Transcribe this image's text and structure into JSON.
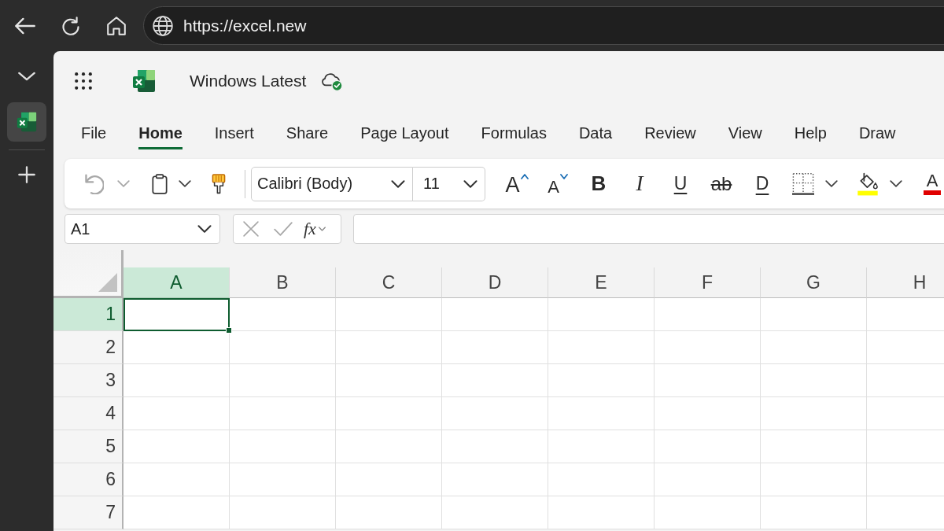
{
  "browser": {
    "url": "https://excel.new"
  },
  "sidebar": {
    "tabs": [
      {
        "selected": true
      }
    ]
  },
  "app": {
    "document_title": "Windows Latest"
  },
  "tabs": [
    {
      "label": "File",
      "selected": false
    },
    {
      "label": "Home",
      "selected": true
    },
    {
      "label": "Insert",
      "selected": false
    },
    {
      "label": "Share",
      "selected": false
    },
    {
      "label": "Page Layout",
      "selected": false
    },
    {
      "label": "Formulas",
      "selected": false
    },
    {
      "label": "Data",
      "selected": false
    },
    {
      "label": "Review",
      "selected": false
    },
    {
      "label": "View",
      "selected": false
    },
    {
      "label": "Help",
      "selected": false
    },
    {
      "label": "Draw",
      "selected": false
    }
  ],
  "ribbon": {
    "undo": {
      "disabled": true
    },
    "font_name": "Calibri (Body)",
    "font_size": "11",
    "format_buttons": [
      {
        "kind": "grow-font",
        "glyph": "A"
      },
      {
        "kind": "shrink-font",
        "glyph": "A"
      },
      {
        "kind": "bold",
        "glyph": "B"
      },
      {
        "kind": "italic",
        "glyph": "I"
      },
      {
        "kind": "underline",
        "glyph": "U"
      },
      {
        "kind": "strikethrough",
        "glyph": "ab"
      },
      {
        "kind": "double-underline",
        "glyph": "D"
      },
      {
        "kind": "borders"
      },
      {
        "kind": "fill-color"
      },
      {
        "kind": "font-color",
        "glyph": "A"
      }
    ]
  },
  "formula_bar": {
    "name_box": "A1",
    "cancel_disabled": true,
    "enter_disabled": true,
    "function_label": "fx"
  },
  "sheet": {
    "columns": [
      {
        "label": "A",
        "selected": true
      },
      {
        "label": "B",
        "selected": false
      },
      {
        "label": "C",
        "selected": false
      },
      {
        "label": "D",
        "selected": false
      },
      {
        "label": "E",
        "selected": false
      },
      {
        "label": "F",
        "selected": false
      },
      {
        "label": "G",
        "selected": false
      },
      {
        "label": "H",
        "selected": false
      }
    ],
    "rows": [
      {
        "label": "1",
        "selected": true
      },
      {
        "label": "2",
        "selected": false
      },
      {
        "label": "3",
        "selected": false
      },
      {
        "label": "4",
        "selected": false
      },
      {
        "label": "5",
        "selected": false
      },
      {
        "label": "6",
        "selected": false
      },
      {
        "label": "7",
        "selected": false
      }
    ]
  }
}
